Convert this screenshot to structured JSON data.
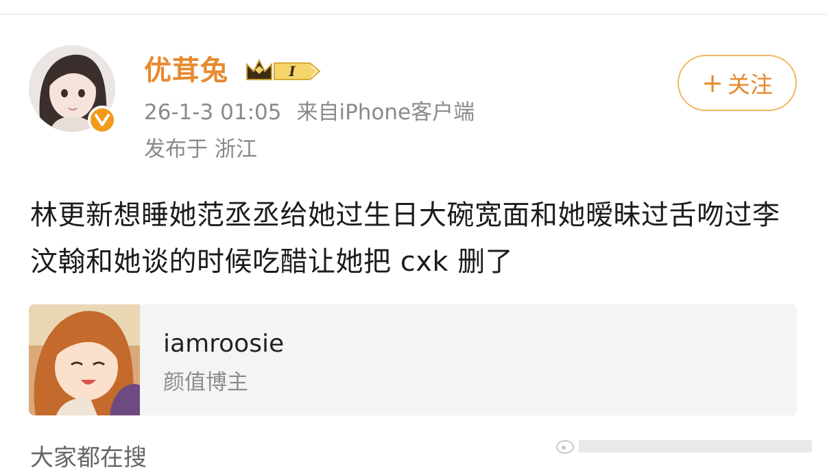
{
  "post": {
    "author": {
      "name": "优茸兔",
      "badge_level": "I",
      "avatar_icon": "user-avatar",
      "verified_icon": "verified-v-icon"
    },
    "timestamp": "26-1-3 01:05",
    "source": "来自iPhone客户端",
    "location": "发布于 浙江",
    "follow_label": "关注",
    "follow_plus": "+",
    "text": "林更新想睡她范丞丞给她过生日大碗宽面和她暧昧过舌吻过李汶翰和她谈的时候吃醋让她把 cxk 删了"
  },
  "card": {
    "title": "iamroosie",
    "subtitle": "颜值博主"
  },
  "footer": {
    "label": "大家都在搜"
  },
  "colors": {
    "accent": "#e68a2e",
    "follow_border": "#f0b860",
    "meta_text": "#8a8a8a",
    "card_bg": "#f4f4f4"
  }
}
